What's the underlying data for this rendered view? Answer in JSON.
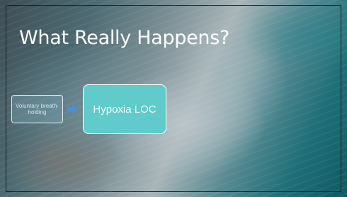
{
  "slide": {
    "title": "What Really Happens?"
  },
  "diagram": {
    "nodes": [
      {
        "label": "Voluntary breath-holding"
      },
      {
        "label": "Hypoxia LOC"
      }
    ],
    "connector_icon": "arrow-right-icon",
    "colors": {
      "arrow": "#4a90d9",
      "node_highlight": "#5fcbcb"
    }
  }
}
